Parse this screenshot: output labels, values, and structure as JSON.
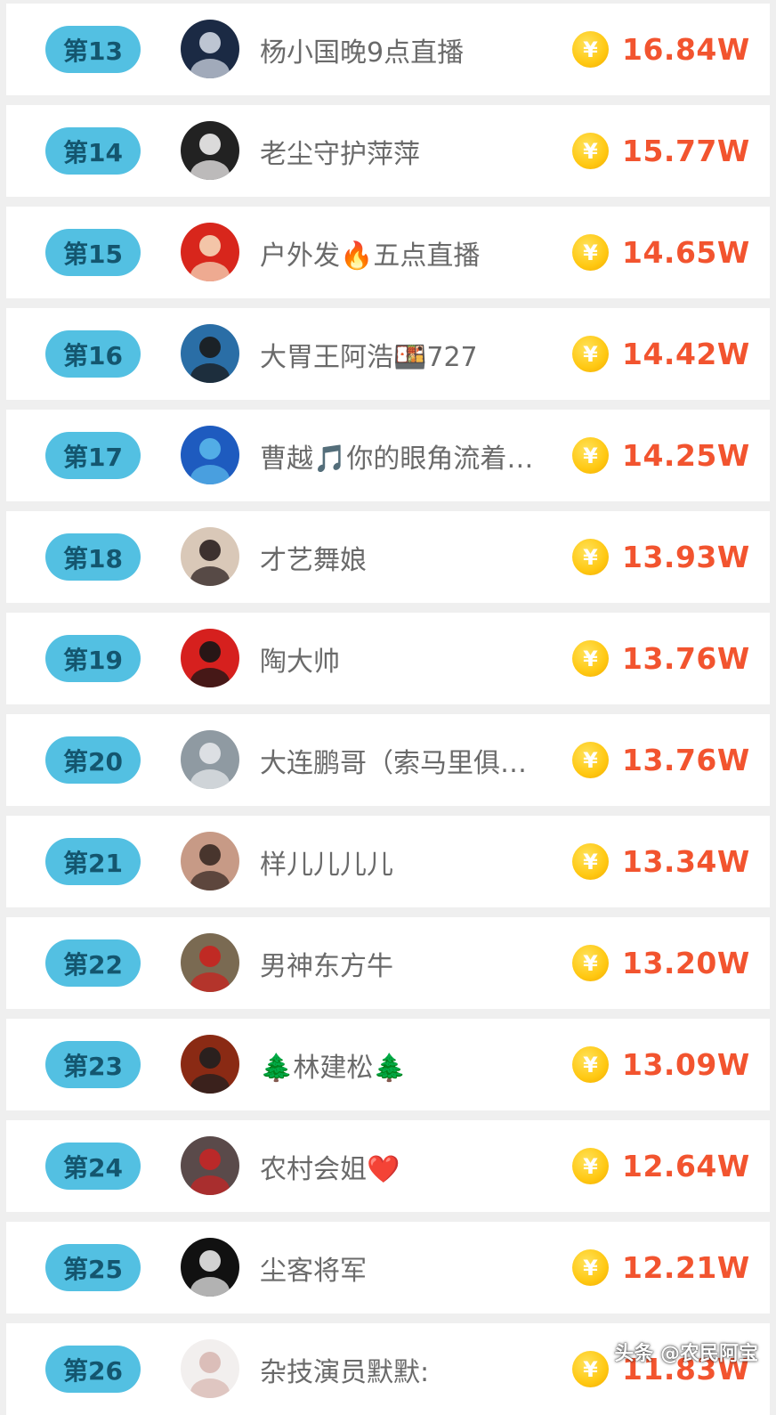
{
  "colors": {
    "rank_badge": "#53c0e2",
    "rank_text": "#14566f",
    "amount_text": "#f2542f",
    "coin": "#ffc812",
    "name_text": "#6a6a6a"
  },
  "coin_icon_glyph": "¥",
  "entries": [
    {
      "rank": "第13",
      "name": "杨小国晚9点直播",
      "amount": "16.84W",
      "avatar_colors": [
        "#1b2a44",
        "#cfd6e2"
      ]
    },
    {
      "rank": "第14",
      "name": "老尘守护萍萍",
      "amount": "15.77W",
      "avatar_colors": [
        "#222222",
        "#f0eeee"
      ]
    },
    {
      "rank": "第15",
      "name": "户外发🔥五点直播",
      "amount": "14.65W",
      "avatar_colors": [
        "#d8261c",
        "#f6d7b8"
      ]
    },
    {
      "rank": "第16",
      "name": "大胃王阿浩🍱727",
      "amount": "14.42W",
      "avatar_colors": [
        "#2a6ea6",
        "#1a1a1a"
      ]
    },
    {
      "rank": "第17",
      "name": "曹越🎵你的眼角流着…",
      "amount": "14.25W",
      "avatar_colors": [
        "#1e5bbf",
        "#58b6ea"
      ]
    },
    {
      "rank": "第18",
      "name": "才艺舞娘",
      "amount": "13.93W",
      "avatar_colors": [
        "#d9c8b8",
        "#2b2020"
      ]
    },
    {
      "rank": "第19",
      "name": "陶大帅",
      "amount": "13.76W",
      "avatar_colors": [
        "#d6201e",
        "#151515"
      ]
    },
    {
      "rank": "第20",
      "name": "大连鹏哥（索马里俱…",
      "amount": "13.76W",
      "avatar_colors": [
        "#8f9aa2",
        "#e4e7ea"
      ]
    },
    {
      "rank": "第21",
      "name": "样儿儿儿儿",
      "amount": "13.34W",
      "avatar_colors": [
        "#c79a86",
        "#3a2a24"
      ]
    },
    {
      "rank": "第22",
      "name": "男神东方牛",
      "amount": "13.20W",
      "avatar_colors": [
        "#7a6a52",
        "#c8231f"
      ]
    },
    {
      "rank": "第23",
      "name": "🌲林建松🌲",
      "amount": "13.09W",
      "avatar_colors": [
        "#8a2a14",
        "#1f1f1f"
      ]
    },
    {
      "rank": "第24",
      "name": "农村会姐❤️",
      "amount": "12.64W",
      "avatar_colors": [
        "#5a4a4a",
        "#c42626"
      ]
    },
    {
      "rank": "第25",
      "name": "尘客将军",
      "amount": "12.21W",
      "avatar_colors": [
        "#111111",
        "#e8e8e8"
      ]
    },
    {
      "rank": "第26",
      "name": "杂技演员默默:",
      "amount": "11.83W",
      "avatar_colors": [
        "#f2efee",
        "#d8b8b2"
      ]
    }
  ],
  "watermark": "头条 @农民阿宝"
}
